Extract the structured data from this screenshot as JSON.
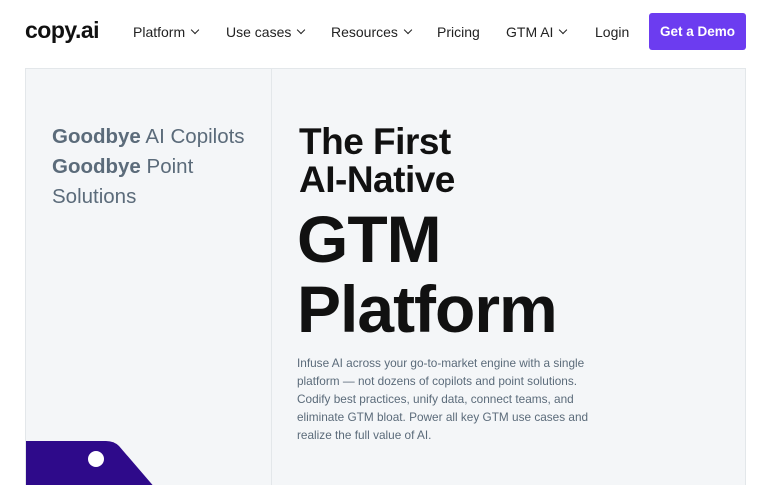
{
  "nav": {
    "logo": "copy.ai",
    "items": [
      {
        "label": "Platform"
      },
      {
        "label": "Use cases"
      },
      {
        "label": "Resources"
      },
      {
        "label": "Pricing"
      },
      {
        "label": "GTM AI"
      }
    ],
    "login": "Login",
    "demo": "Get a Demo"
  },
  "hero": {
    "goodbye_1_bold": "Goodbye",
    "goodbye_1_rest": "AI Copilots",
    "goodbye_2_bold": "Goodbye",
    "goodbye_2_rest": "Point Solutions",
    "headline_line1": "The First",
    "headline_line2": "AI-Native",
    "headline_big1": "GTM",
    "headline_big2": "Platform",
    "description": "Infuse AI across your go-to-market engine with a single platform — not dozens of copilots and point solutions. Codify best practices, unify data, connect teams, and eliminate GTM bloat. Power all key GTM use cases and realize the full value of AI."
  },
  "colors": {
    "brand_purple": "#6c3cf0",
    "deco_purple": "#2e0a8a",
    "hero_bg": "#f4f6f8",
    "muted_text": "#5b6b7a"
  }
}
